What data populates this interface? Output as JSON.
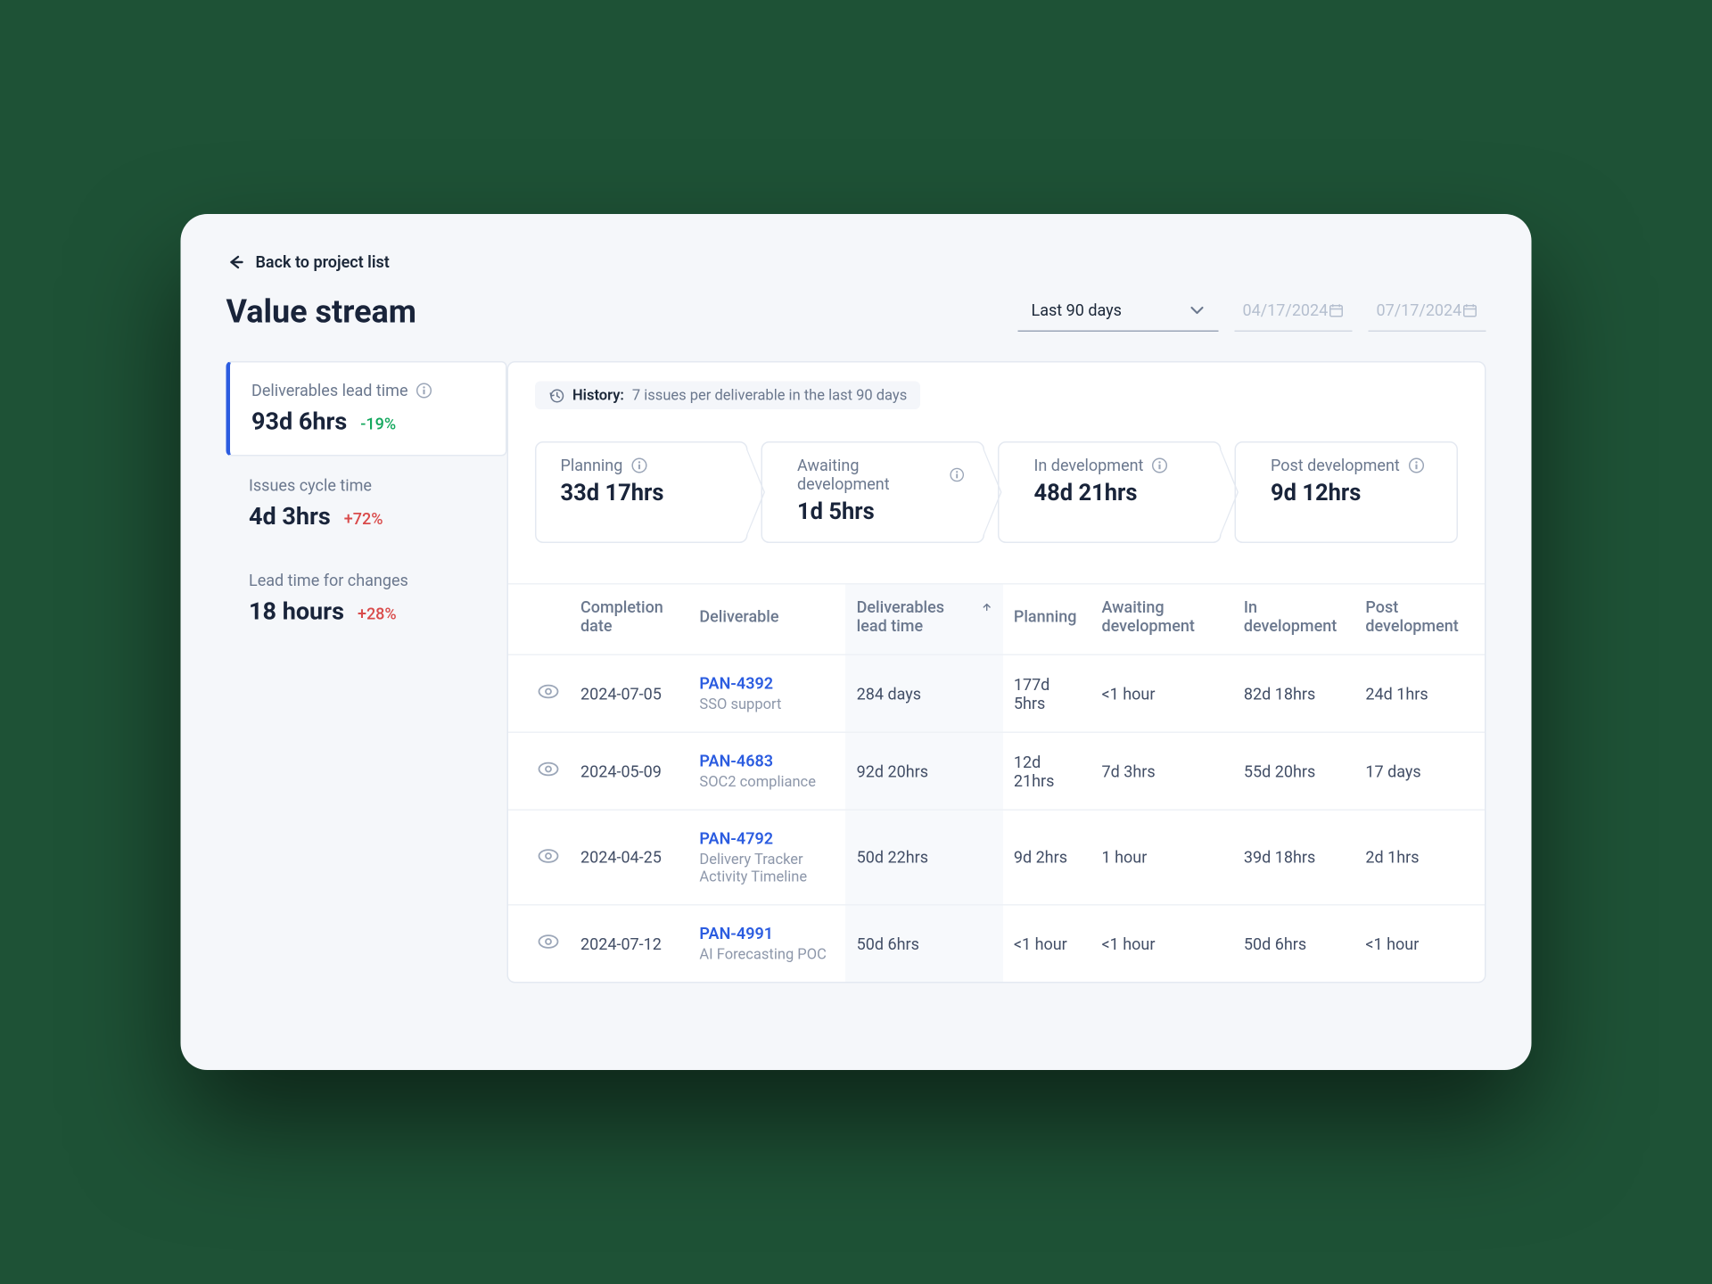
{
  "nav": {
    "back_label": "Back to project list"
  },
  "page_title": "Value stream",
  "filters": {
    "range": "Last 90 days",
    "date_from": "04/17/2024",
    "date_to": "07/17/2024"
  },
  "side_metrics": [
    {
      "label": "Deliverables lead time",
      "value": "93d 6hrs",
      "delta": "-19%",
      "dir": "down"
    },
    {
      "label": "Issues cycle time",
      "value": "4d 3hrs",
      "delta": "+72%",
      "dir": "up"
    },
    {
      "label": "Lead time for changes",
      "value": "18 hours",
      "delta": "+28%",
      "dir": "up"
    }
  ],
  "history": {
    "prefix": "History:",
    "text": "7 issues per deliverable in the last 90 days"
  },
  "pipeline": [
    {
      "label": "Planning",
      "value": "33d 17hrs"
    },
    {
      "label": "Awaiting development",
      "value": "1d 5hrs"
    },
    {
      "label": "In development",
      "value": "48d 21hrs"
    },
    {
      "label": "Post development",
      "value": "9d 12hrs"
    }
  ],
  "columns": {
    "completion": "Completion date",
    "deliverable": "Deliverable",
    "lead": "Deliverables lead time",
    "planning": "Planning",
    "awaiting": "Awaiting development",
    "indev": "In development",
    "post": "Post development"
  },
  "rows": [
    {
      "date": "2024-07-05",
      "key": "PAN-4392",
      "name": "SSO support",
      "lead": "284 days",
      "planning": "177d 5hrs",
      "awaiting": "<1 hour",
      "indev": "82d 18hrs",
      "post": "24d 1hrs"
    },
    {
      "date": "2024-05-09",
      "key": "PAN-4683",
      "name": "SOC2 compliance",
      "lead": "92d 20hrs",
      "planning": "12d 21hrs",
      "awaiting": "7d 3hrs",
      "indev": "55d 20hrs",
      "post": "17 days"
    },
    {
      "date": "2024-04-25",
      "key": "PAN-4792",
      "name": "Delivery Tracker Activity Timeline",
      "lead": "50d 22hrs",
      "planning": "9d 2hrs",
      "awaiting": "1 hour",
      "indev": "39d 18hrs",
      "post": "2d 1hrs"
    },
    {
      "date": "2024-07-12",
      "key": "PAN-4991",
      "name": "AI Forecasting POC",
      "lead": "50d 6hrs",
      "planning": "<1 hour",
      "awaiting": "<1 hour",
      "indev": "50d 6hrs",
      "post": "<1 hour"
    }
  ]
}
